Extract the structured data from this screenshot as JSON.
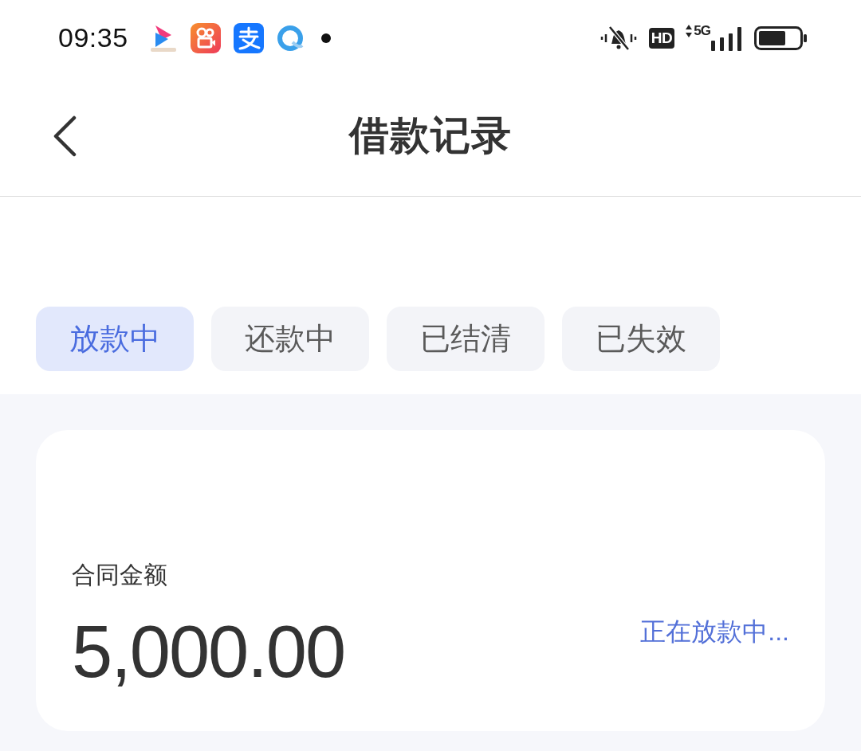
{
  "status_bar": {
    "time": "09:35",
    "hd": "HD",
    "network": "5G"
  },
  "header": {
    "title": "借款记录"
  },
  "tabs": [
    {
      "label": "放款中",
      "selected": true
    },
    {
      "label": "还款中",
      "selected": false
    },
    {
      "label": "已结清",
      "selected": false
    },
    {
      "label": "已失效",
      "selected": false
    }
  ],
  "loans": [
    {
      "amount_label": "合同金额",
      "amount": "5,000.00",
      "status": "正在放款中..."
    }
  ]
}
